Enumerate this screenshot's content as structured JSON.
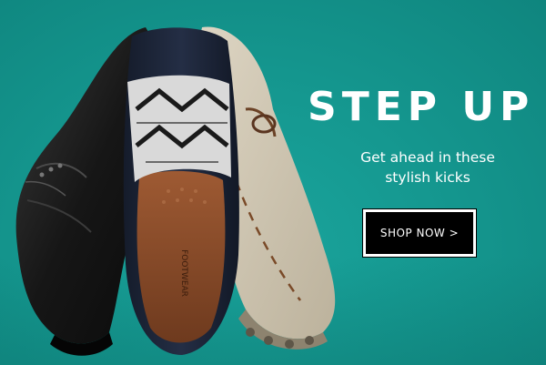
{
  "banner": {
    "headline": "STEP UP",
    "subline_line1": "Get ahead in these",
    "subline_line2": "stylish kicks",
    "cta_label": "SHOP NOW >",
    "insole_brand": "FOOTWEAR"
  },
  "colors": {
    "background": "#159890",
    "text": "#ffffff",
    "button_bg": "#000000"
  }
}
